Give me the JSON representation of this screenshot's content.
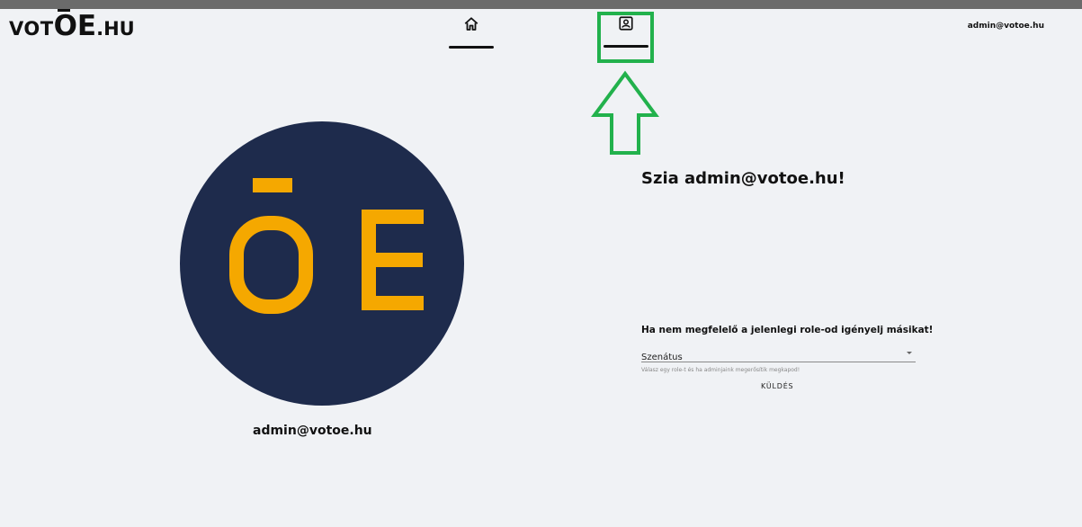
{
  "header": {
    "logo": {
      "prefix": "VOT",
      "mark": "OE",
      "suffix": ".HU"
    },
    "user_email": "admin@votoe.hu",
    "tabs": [
      {
        "name": "home",
        "icon": "home-icon"
      },
      {
        "name": "profile",
        "icon": "profile-icon"
      }
    ]
  },
  "profile": {
    "avatar_icon": "oe-logo",
    "name": "admin@votoe.hu"
  },
  "main": {
    "greeting": "Szia admin@votoe.hu!",
    "role_title": "Ha nem megfelelő a jelenlegi role-od igényelj másikat!",
    "role_select_value": "Szenátus",
    "helper_text": "Válasz egy role-t és ha adminjaink megerősítik megkapod!",
    "submit_label": "KÜLDÉS"
  },
  "annotation": {
    "color": "#22b14c"
  },
  "colors": {
    "avatar_bg": "#1e2b4c",
    "logo_accent": "#f5a800",
    "page_bg": "#f0f2f5"
  }
}
